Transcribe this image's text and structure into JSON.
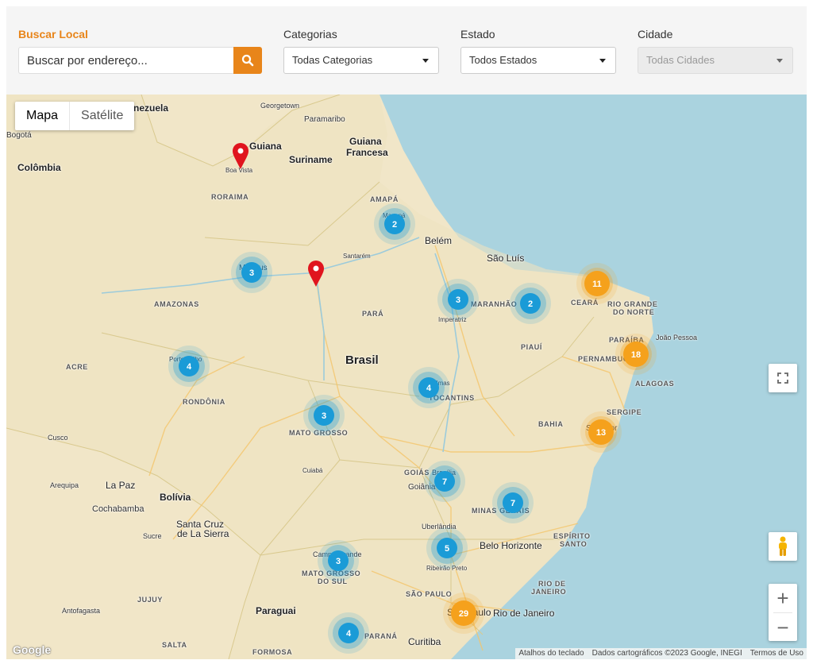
{
  "filters": {
    "search": {
      "label": "Buscar Local",
      "placeholder": "Buscar por endereço..."
    },
    "categorias": {
      "label": "Categorias",
      "value": "Todas Categorias"
    },
    "estado": {
      "label": "Estado",
      "value": "Todos Estados"
    },
    "cidade": {
      "label": "Cidade",
      "value": "Todas Cidades"
    },
    "accent_color": "#e8851a"
  },
  "map": {
    "maptype": {
      "mapa": "Mapa",
      "satelite": "Satélite"
    },
    "attribution": {
      "shortcuts": "Atalhos do teclado",
      "data": "Dados cartográficos ©2023 Google, INEGI",
      "terms": "Termos de Uso"
    },
    "logo": "Google",
    "labels": {
      "venezuela": "nezuela",
      "georgetown": "Georgetown",
      "paramaribo": "Paramaribo",
      "bogota": "Bogotá",
      "guiana": "Guiana",
      "suriname": "Suriname",
      "guiana_francesa_1": "Guiana",
      "guiana_francesa_2": "Francesa",
      "colombia": "Colômbia",
      "boa_vista": "Boa Vista",
      "roraima": "RORAIMA",
      "amapa": "AMAPÁ",
      "macapa": "Macapá",
      "belem": "Belém",
      "santarem": "Santarém",
      "sao_luis": "São Luís",
      "manaus": "Manaus",
      "amazonas": "AMAZONAS",
      "maranhao": "MARANHÃO",
      "imperatriz": "Imperatriz",
      "para": "PARÁ",
      "ceara": "CEARÁ",
      "rio_grande_norte_1": "RIO GRANDE",
      "rio_grande_norte_2": "DO NORTE",
      "paraiba": "PARAÍBA",
      "joao_pessoa": "João Pessoa",
      "piaui": "PIAUÍ",
      "pernambuco": "PERNAMBUCO",
      "brasil": "Brasil",
      "acre": "ACRE",
      "porto_velho": "Porto Velho",
      "palmas": "Palmas",
      "tocantins": "TOCANTINS",
      "alagoas": "ALAGOAS",
      "rondonia": "RONDÔNIA",
      "sergipe": "SERGIPE",
      "bahia": "BAHIA",
      "salvador": "Salvador",
      "mato_grosso": "MATO GROSSO",
      "cusco": "Cusco",
      "cuiaba": "Cuiabá",
      "goias": "GOIÁS",
      "brasilia": "Brasília",
      "goiania": "Goiânia",
      "arequipa": "Arequipa",
      "la_paz": "La Paz",
      "bolivia": "Bolívia",
      "minas_gerais": "MINAS GERAIS",
      "cochabamba": "Cochabamba",
      "santa_cruz_1": "Santa Cruz",
      "santa_cruz_2": "de La Sierra",
      "sucre": "Sucre",
      "uberlandia": "Uberlândia",
      "belo_horizonte": "Belo Horizonte",
      "espirito_santo_1": "ESPÍRITO",
      "espirito_santo_2": "SANTO",
      "campo_grande": "Campo Grande",
      "ms_1": "MATO GROSSO",
      "ms_2": "DO SUL",
      "ribeirao_preto": "Ribeirão Preto",
      "rio_estado_1": "RIO DE",
      "rio_estado_2": "JANEIRO",
      "jujuy": "JUJUY",
      "sao_paulo_estado": "SÃO PAULO",
      "antofagasta": "Antofagasta",
      "paraguai": "Paraguai",
      "sao_paulo": "São Paulo",
      "rio_de_janeiro": "Rio de Janeiro",
      "salta": "SALTA",
      "parana": "PARANÁ",
      "curitiba": "Curitiba",
      "formosa": "FORMOSA"
    },
    "clusters": [
      {
        "count": "2",
        "color": "blue"
      },
      {
        "count": "3",
        "color": "blue"
      },
      {
        "count": "3",
        "color": "blue"
      },
      {
        "count": "2",
        "color": "blue"
      },
      {
        "count": "11",
        "color": "orange"
      },
      {
        "count": "18",
        "color": "orange"
      },
      {
        "count": "4",
        "color": "blue"
      },
      {
        "count": "4",
        "color": "blue"
      },
      {
        "count": "3",
        "color": "blue"
      },
      {
        "count": "13",
        "color": "orange"
      },
      {
        "count": "7",
        "color": "blue"
      },
      {
        "count": "7",
        "color": "blue"
      },
      {
        "count": "5",
        "color": "blue"
      },
      {
        "count": "3",
        "color": "blue"
      },
      {
        "count": "29",
        "color": "orange"
      },
      {
        "count": "4",
        "color": "blue"
      }
    ],
    "cluster_colors": {
      "blue": "#1a9bd7",
      "orange": "#f5a11c"
    },
    "marker_color": "#e0141e"
  }
}
